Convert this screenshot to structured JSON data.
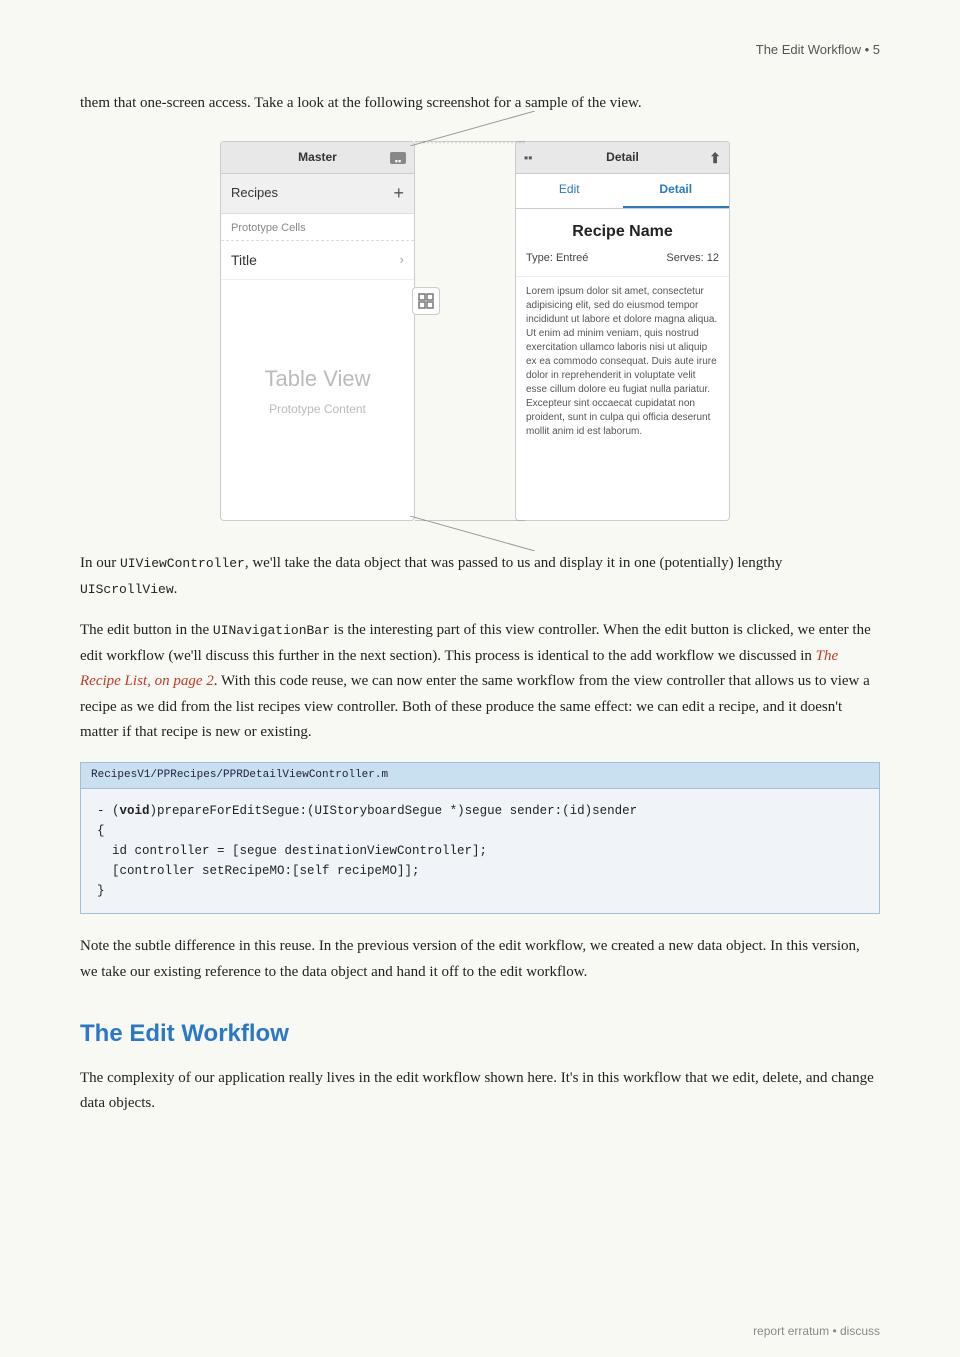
{
  "header": {
    "text": "The Edit Workflow • 5"
  },
  "intro": {
    "text": "them that one-screen access. Take a look at the following screenshot for a sample of the view."
  },
  "mockup": {
    "master": {
      "nav_title": "Master",
      "recipes_label": "Recipes",
      "prototype_cells": "Prototype Cells",
      "title_label": "Title",
      "table_view_label": "Table View",
      "table_view_sub": "Prototype Content"
    },
    "detail": {
      "nav_title": "Detail",
      "tab_edit": "Edit",
      "tab_detail": "Detail",
      "recipe_name": "Recipe Name",
      "type_label": "Type: Entreé",
      "serves_label": "Serves: 12",
      "description": "Lorem ipsum dolor sit amet, consectetur adipisicing elit, sed do eiusmod tempor incididunt ut labore et dolore magna aliqua. Ut enim ad minim veniam, quis nostrud exercitation ullamco laboris nisi ut aliquip ex ea commodo consequat. Duis aute irure dolor in reprehenderit in voluptate velit esse cillum dolore eu fugiat nulla pariatur. Excepteur sint occaecat cupidatat non proident, sunt in culpa qui officia deserunt mollit anim id est laborum."
    }
  },
  "body_paragraphs": [
    {
      "id": "p1",
      "text": "In our UIViewController, we'll take the data object that was passed to us and display it in one (potentially) lengthy UIScrollView.",
      "code_spans": [
        "UIViewController",
        "UIScrollView"
      ]
    },
    {
      "id": "p2",
      "text": "The edit button in the UINavigationBar is the interesting part of this view controller. When the edit button is clicked, we enter the edit workflow (we'll discuss this further in the next section). This process is identical to the add workflow we discussed in The Recipe List, on page 2. With this code reuse, we can now enter the same workflow from the view controller that allows us to view a recipe as we did from the list recipes view controller. Both of these produce the same effect: we can edit a recipe, and it doesn't matter if that recipe is new or existing.",
      "code_spans": [
        "UINavigationBar"
      ],
      "link_text": "The Recipe List, on page 2"
    }
  ],
  "code_block": {
    "file_path": "RecipesV1/PPRecipes/PPRDetailViewController.m",
    "lines": [
      "- (void)prepareForEditSegue:(UIStoryboardSegue *)segue sender:(id)sender",
      "{",
      "  id controller = [segue destinationViewController];",
      "  [controller setRecipeMO:[self recipeMO]];",
      "}"
    ],
    "bold_keyword": "void"
  },
  "note_paragraph": {
    "text": "Note the subtle difference in this reuse. In the previous version of the edit workflow, we created a new data object. In this version, we take our existing reference to the data object and hand it off to the edit workflow."
  },
  "section": {
    "heading": "The Edit Workflow",
    "text": "The complexity of our application really lives in the edit workflow shown here. It's in this workflow that we edit, delete, and change data objects."
  },
  "footer": {
    "report": "report erratum",
    "discuss": "discuss",
    "separator": " • "
  }
}
